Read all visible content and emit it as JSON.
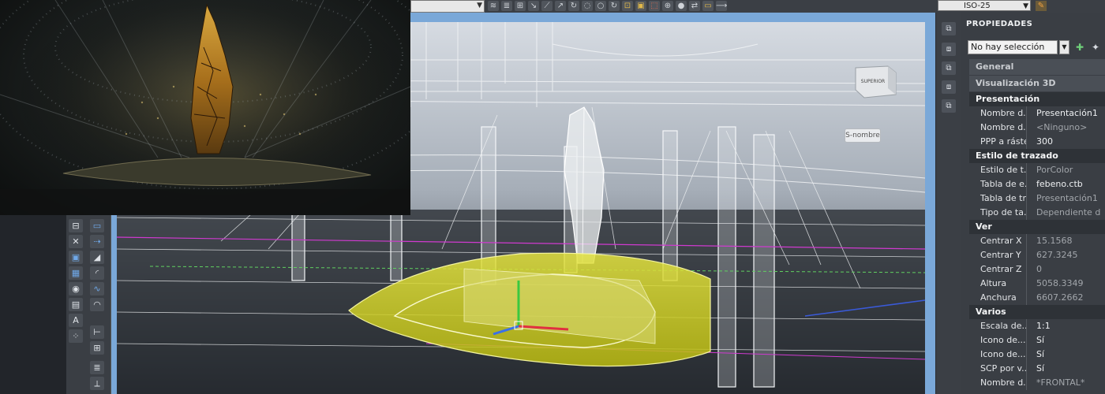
{
  "toolbar": {
    "dimension_style": "ISO-25",
    "icons": [
      "layer-states-icon",
      "layer-match-icon",
      "move-icon",
      "copy-icon",
      "mirror-icon",
      "stretch-icon",
      "rotate-icon",
      "offset-icon",
      "explode-icon",
      "array-icon",
      "fillet-icon",
      "block-icon",
      "insert-icon",
      "attribute-icon",
      "table-icon",
      "text-icon",
      "dimension-icon",
      "leader-icon"
    ]
  },
  "viewport": {
    "viewcube_label": "SUPERIOR",
    "named_view": "S-nombre"
  },
  "tool_palette": {
    "items": [
      "draw-line-icon",
      "polyline-icon",
      "circle-icon",
      "arc-icon",
      "rectangle-icon",
      "hatch-icon",
      "block-icon",
      "region-icon",
      "text-icon",
      "insert-icon",
      "table-icon",
      "point-icon",
      "revcloud-icon",
      "gradient-icon",
      "spline-icon",
      "ellipse-icon",
      "field-icon",
      "measure-icon"
    ]
  },
  "properties": {
    "title": "PROPIEDADES",
    "selection": "No hay selección",
    "categories": [
      {
        "label": "General"
      },
      {
        "label": "Visualización 3D"
      }
    ],
    "sections": [
      {
        "title": "Presentación",
        "rows": [
          {
            "label": "Nombre d...",
            "value": "Presentación1"
          },
          {
            "label": "Nombre d...",
            "value": "<Ninguno>",
            "muted": true
          },
          {
            "label": "PPP a ráster",
            "value": "300"
          }
        ]
      },
      {
        "title": "Estilo de trazado",
        "rows": [
          {
            "label": "Estilo de t...",
            "value": "PorColor",
            "muted": true
          },
          {
            "label": "Tabla de e...",
            "value": "febeno.ctb"
          },
          {
            "label": "Tabla de tr...",
            "value": "Presentación1",
            "muted": true
          },
          {
            "label": "Tipo de ta...",
            "value": "Dependiente d",
            "muted": true
          }
        ]
      },
      {
        "title": "Ver",
        "rows": [
          {
            "label": "Centrar X",
            "value": "15.1568",
            "muted": true
          },
          {
            "label": "Centrar Y",
            "value": "627.3245",
            "muted": true
          },
          {
            "label": "Centrar Z",
            "value": "0",
            "muted": true
          },
          {
            "label": "Altura",
            "value": "5058.3349",
            "muted": true
          },
          {
            "label": "Anchura",
            "value": "6607.2662",
            "muted": true
          }
        ]
      },
      {
        "title": "Varios",
        "rows": [
          {
            "label": "Escala de...",
            "value": "1:1"
          },
          {
            "label": "Icono de...",
            "value": "Sí"
          },
          {
            "label": "Icono de...",
            "value": "Sí"
          },
          {
            "label": "SCP por v...",
            "value": "Sí"
          },
          {
            "label": "Nombre d...",
            "value": "*FRONTAL*",
            "muted": true
          }
        ]
      }
    ]
  },
  "colors": {
    "accent_yellow": "#d8d820",
    "viewport_sky": "#c8cfd8",
    "panel_bg": "#3a3e44"
  }
}
